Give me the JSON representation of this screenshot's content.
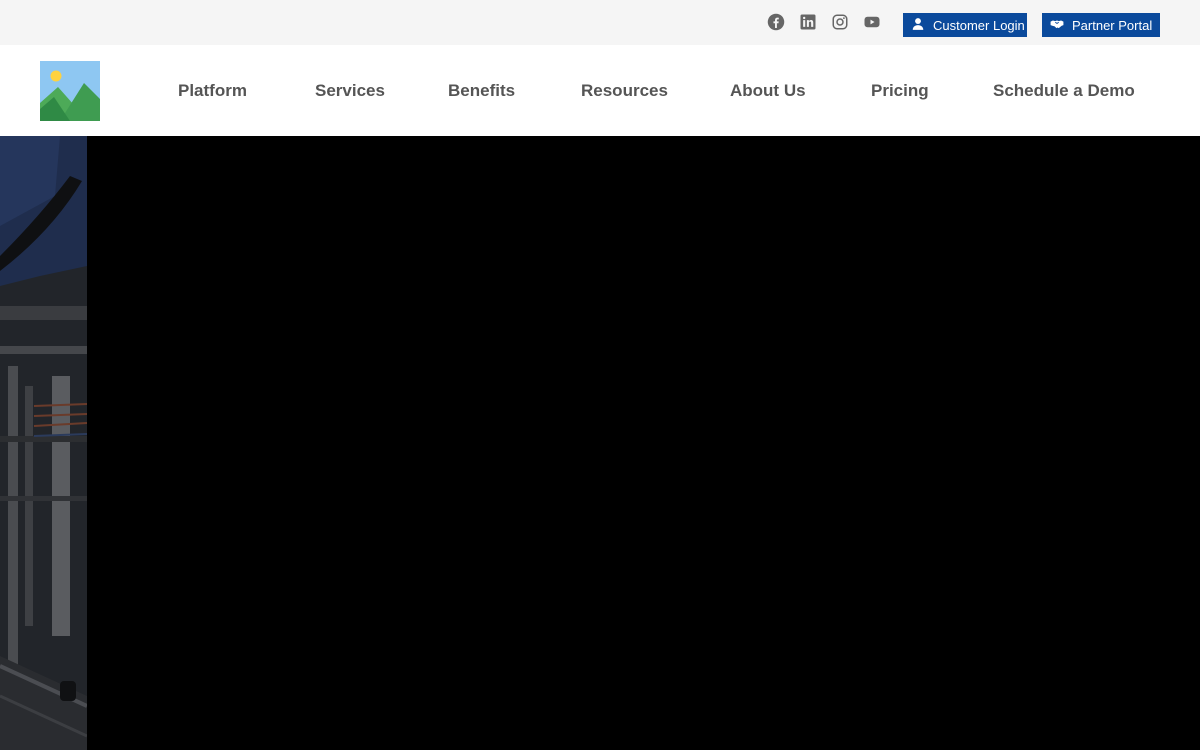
{
  "topbar": {
    "social": [
      {
        "icon": "facebook-icon"
      },
      {
        "icon": "linkedin-icon"
      },
      {
        "icon": "instagram-icon"
      },
      {
        "icon": "youtube-icon"
      }
    ],
    "customer_login": {
      "label": "Customer Login",
      "icon": "user-icon"
    },
    "partner_portal": {
      "label": "Partner Portal",
      "icon": "handshake-icon"
    },
    "colors": {
      "button_bg": "#0b4a9c",
      "bar_bg": "#f5f5f5",
      "icon_color": "#666666"
    }
  },
  "header": {
    "logo": {
      "icon": "image-placeholder-icon"
    },
    "nav": [
      {
        "label": "Platform"
      },
      {
        "label": "Services"
      },
      {
        "label": "Benefits"
      },
      {
        "label": "Resources"
      },
      {
        "label": "About Us"
      },
      {
        "label": "Pricing"
      },
      {
        "label": "Schedule a Demo"
      }
    ],
    "colors": {
      "nav_text": "#555555"
    }
  },
  "hero": {
    "background_image": "industrial-machinery-photo",
    "overlay_color": "#000000"
  }
}
